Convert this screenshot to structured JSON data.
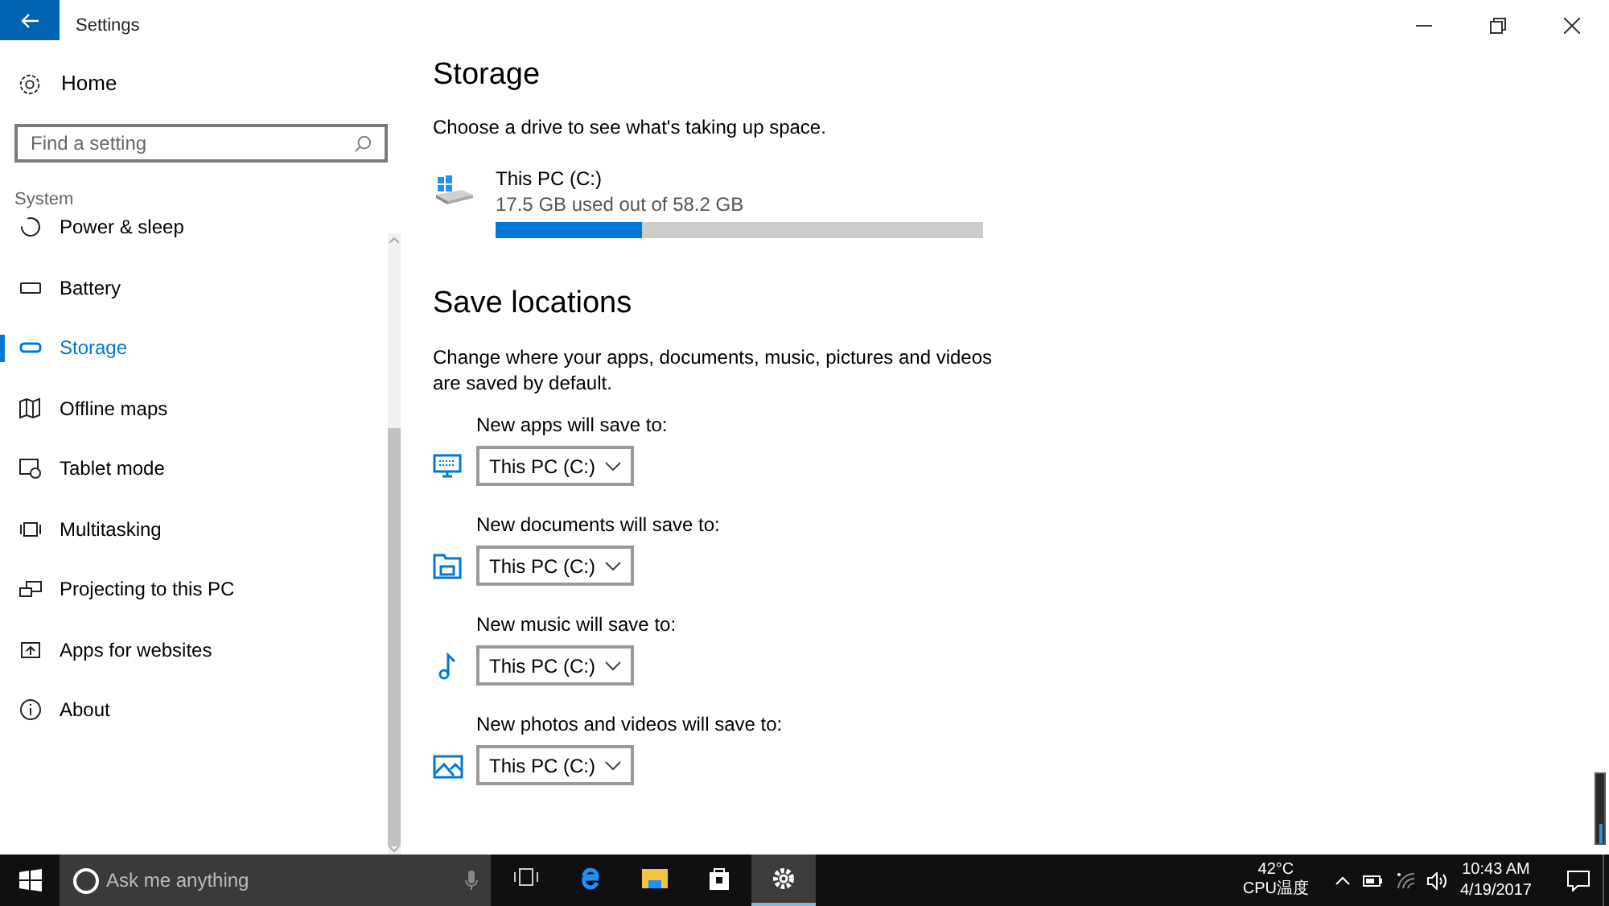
{
  "window": {
    "title": "Settings"
  },
  "sidebar": {
    "home": "Home",
    "search": {
      "placeholder": "Find a setting"
    },
    "section": "System",
    "items": [
      {
        "label": "Power & sleep",
        "selected": false
      },
      {
        "label": "Battery",
        "selected": false
      },
      {
        "label": "Storage",
        "selected": true
      },
      {
        "label": "Offline maps",
        "selected": false
      },
      {
        "label": "Tablet mode",
        "selected": false
      },
      {
        "label": "Multitasking",
        "selected": false
      },
      {
        "label": "Projecting to this PC",
        "selected": false
      },
      {
        "label": "Apps for websites",
        "selected": false
      },
      {
        "label": "About",
        "selected": false
      }
    ]
  },
  "storage": {
    "heading": "Storage",
    "description": "Choose a drive to see what's taking up space.",
    "drives": [
      {
        "name": "This PC (C:)",
        "usage": "17.5 GB used out of 58.2 GB",
        "level": 0.3
      }
    ]
  },
  "save_locations": {
    "heading": "Save locations",
    "description": "Change where your apps, documents, music, pictures and videos are saved by default.",
    "rows": [
      {
        "label": "New apps will save to:",
        "value": "This PC (C:)"
      },
      {
        "label": "New documents will save to:",
        "value": "This PC (C:)"
      },
      {
        "label": "New music will save to:",
        "value": "This PC (C:)"
      },
      {
        "label": "New photos and videos will save to:",
        "value": "This PC (C:)"
      }
    ]
  },
  "taskbar": {
    "search": {
      "placeholder": "Ask me anything"
    },
    "apps": [
      {
        "selected": false
      },
      {
        "selected": false
      },
      {
        "selected": false
      },
      {
        "selected": false
      },
      {
        "selected": true
      }
    ],
    "tray": {
      "temperature": "42°C",
      "sensor": "CPU温度",
      "time": "10:43 AM",
      "date": "4/19/2017"
    }
  }
}
